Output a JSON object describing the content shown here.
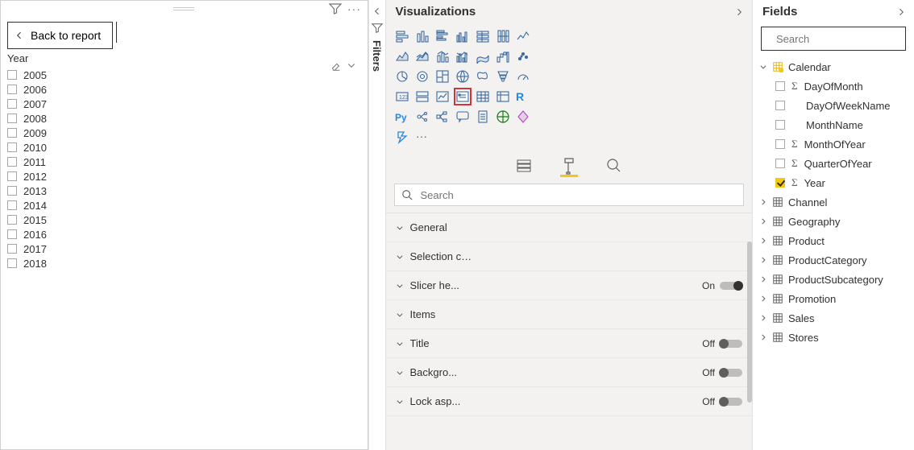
{
  "canvas": {
    "back_label": "Back to report",
    "slicer_title": "Year",
    "years": [
      "2005",
      "2006",
      "2007",
      "2008",
      "2009",
      "2010",
      "2011",
      "2012",
      "2013",
      "2014",
      "2015",
      "2016",
      "2017",
      "2018"
    ]
  },
  "filters": {
    "label": "Filters"
  },
  "viz": {
    "title": "Visualizations",
    "search_placeholder": "Search",
    "icons": [
      "stacked-bar",
      "stacked-column",
      "clustered-bar",
      "clustered-column",
      "stacked-bar-100",
      "stacked-column-100",
      "line",
      "area",
      "stacked-area",
      "line-stacked-column",
      "line-clustered-column",
      "ribbon",
      "waterfall",
      "scatter",
      "pie",
      "donut",
      "treemap",
      "map",
      "filled-map",
      "funnel",
      "gauge",
      "card",
      "multi-row-card",
      "kpi",
      "slicer-visual",
      "table",
      "matrix",
      "r-visual",
      "py-visual",
      "key-influencers",
      "decomposition",
      "qa-visual",
      "paginated",
      "arcgis",
      "power-apps",
      "power-automate",
      "more"
    ],
    "format_sections": [
      {
        "name": "General",
        "toggle": null
      },
      {
        "name": "Selection controls",
        "toggle": null
      },
      {
        "name": "Slicer he...",
        "toggle": "On"
      },
      {
        "name": "Items",
        "toggle": null
      },
      {
        "name": "Title",
        "toggle": "Off"
      },
      {
        "name": "Backgro...",
        "toggle": "Off"
      },
      {
        "name": "Lock asp...",
        "toggle": "Off"
      }
    ]
  },
  "fields": {
    "title": "Fields",
    "search_placeholder": "Search",
    "tables": [
      {
        "name": "Calendar",
        "expanded": true,
        "highlighted": true,
        "fields": [
          {
            "name": "DayOfMonth",
            "sigma": true,
            "checked": false
          },
          {
            "name": "DayOfWeekName",
            "sigma": false,
            "checked": false
          },
          {
            "name": "MonthName",
            "sigma": false,
            "checked": false
          },
          {
            "name": "MonthOfYear",
            "sigma": true,
            "checked": false
          },
          {
            "name": "QuarterOfYear",
            "sigma": true,
            "checked": false
          },
          {
            "name": "Year",
            "sigma": true,
            "checked": true
          }
        ]
      },
      {
        "name": "Channel",
        "expanded": false
      },
      {
        "name": "Geography",
        "expanded": false
      },
      {
        "name": "Product",
        "expanded": false
      },
      {
        "name": "ProductCategory",
        "expanded": false
      },
      {
        "name": "ProductSubcategory",
        "expanded": false
      },
      {
        "name": "Promotion",
        "expanded": false
      },
      {
        "name": "Sales",
        "expanded": false
      },
      {
        "name": "Stores",
        "expanded": false
      }
    ]
  },
  "labels": {
    "on": "On",
    "off": "Off",
    "r": "R",
    "py": "Py",
    "more": "···"
  }
}
